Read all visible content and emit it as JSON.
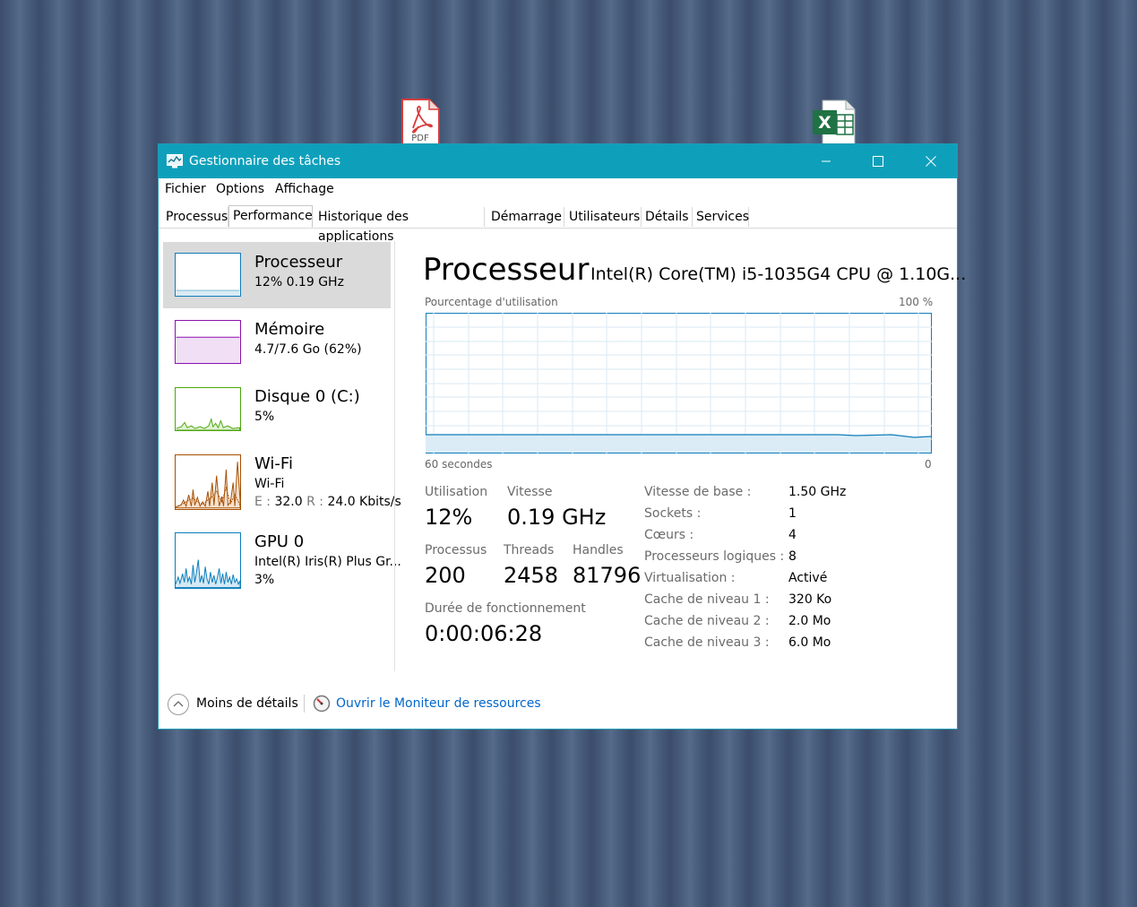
{
  "desktop": {
    "pdf_label": "PDF",
    "excel_label": "X"
  },
  "window": {
    "title": "Gestionnaire des tâches",
    "menu": [
      "Fichier",
      "Options",
      "Affichage"
    ],
    "tabs": [
      "Processus",
      "Performance",
      "Historique des applications",
      "Démarrage",
      "Utilisateurs",
      "Détails",
      "Services"
    ],
    "active_tab": "Performance"
  },
  "sidebar": {
    "items": [
      {
        "name": "Processeur",
        "sub1": "12%  0.19 GHz",
        "color": "#117dbb"
      },
      {
        "name": "Mémoire",
        "sub1": "4.7/7.6 Go (62%)",
        "color": "#8b12ae"
      },
      {
        "name": "Disque 0 (C:)",
        "sub1": "5%",
        "color": "#4da60c"
      },
      {
        "name": "Wi-Fi",
        "sub1": "Wi-Fi",
        "sub2_e_label": "E : ",
        "sub2_e_val": "32.0",
        "sub2_r_label": " R : ",
        "sub2_r_val": "24.0 Kbits/s",
        "color": "#a74f01"
      },
      {
        "name": "GPU 0",
        "sub1": "Intel(R) Iris(R) Plus Gr...",
        "sub2": "3%",
        "color": "#0a7dbb"
      }
    ]
  },
  "main": {
    "title": "Processeur",
    "cpu_name": "Intel(R) Core(TM) i5-1035G4 CPU @ 1.10G...",
    "graph_label": "Pourcentage d'utilisation",
    "graph_max": "100 %",
    "graph_time": "60 secondes",
    "graph_zero": "0",
    "utilisation_label": "Utilisation",
    "utilisation_value": "12%",
    "vitesse_label": "Vitesse",
    "vitesse_value": "0.19 GHz",
    "processus_label": "Processus",
    "processus_value": "200",
    "threads_label": "Threads",
    "threads_value": "2458",
    "handles_label": "Handles",
    "handles_value": "81796",
    "uptime_label": "Durée de fonctionnement",
    "uptime_value": "0:00:06:28",
    "specs": [
      {
        "label": "Vitesse de base :",
        "value": "1.50 GHz"
      },
      {
        "label": "Sockets :",
        "value": "1"
      },
      {
        "label": "Cœurs :",
        "value": "4"
      },
      {
        "label": "Processeurs logiques :",
        "value": "8"
      },
      {
        "label": "Virtualisation :",
        "value": "Activé"
      },
      {
        "label": "Cache de niveau 1 :",
        "value": "320 Ko"
      },
      {
        "label": "Cache de niveau 2 :",
        "value": "2.0 Mo"
      },
      {
        "label": "Cache de niveau 3 :",
        "value": "6.0 Mo"
      }
    ]
  },
  "footer": {
    "less_details": "Moins de détails",
    "resource_monitor": "Ouvrir le Moniteur de ressources"
  },
  "colors": {
    "titlebar": "#0ea0bb",
    "cpu_line": "#117dbb",
    "link": "#0066cc"
  }
}
